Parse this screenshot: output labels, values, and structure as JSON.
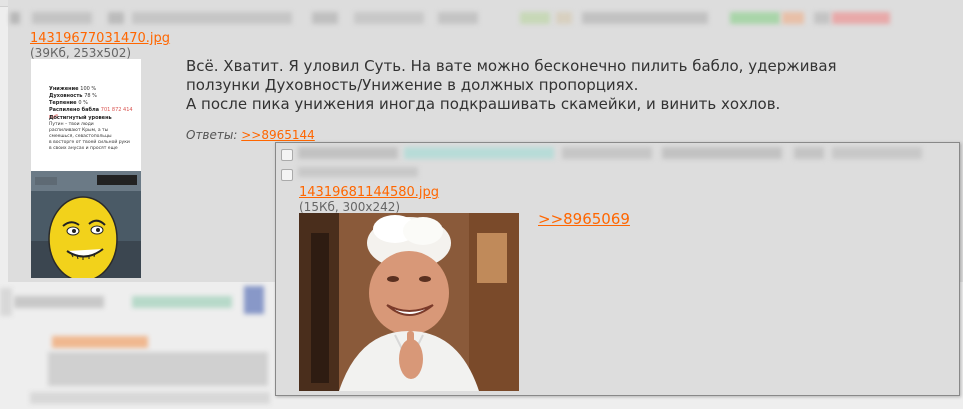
{
  "post": {
    "file_name": "14319677031470.jpg",
    "file_info": "(39Кб, 253x502)",
    "message_lines": [
      "Всё. Хватит. Я уловил Суть. На вате можно бесконечно пилить бабло, удерживая",
      "ползунки Духовность/Унижение в должных пропорциях.",
      "А после пика унижения иногда подкрашивать скамейки, и винить хохлов."
    ],
    "replies_label": "Ответы:",
    "reply_link": ">>8965144",
    "thumb_text": {
      "stats": [
        {
          "label": "Унижение",
          "value": "100 %"
        },
        {
          "label": "Духовность",
          "value": "78 %"
        },
        {
          "label": "Терпение",
          "value": "0 %"
        },
        {
          "label": "Распилено бабла",
          "value": "701 872 414 руб"
        }
      ],
      "level_title": "Достигнутый уровень",
      "level_lines": [
        "Путин – твои люди",
        "распиливают Крым, а ты",
        "смеешься, севастопольцы",
        "в восторге от твоей сильной руки",
        "в своих анусах и просят еще"
      ]
    }
  },
  "popup": {
    "file_name": "14319681144580.jpg",
    "file_info": "(15Кб, 300x242)",
    "quote_link": ">>8965069"
  },
  "colors": {
    "accent_link": "#ff6600",
    "post_bg": "#dddddd",
    "page_bg": "#eeeeee"
  }
}
